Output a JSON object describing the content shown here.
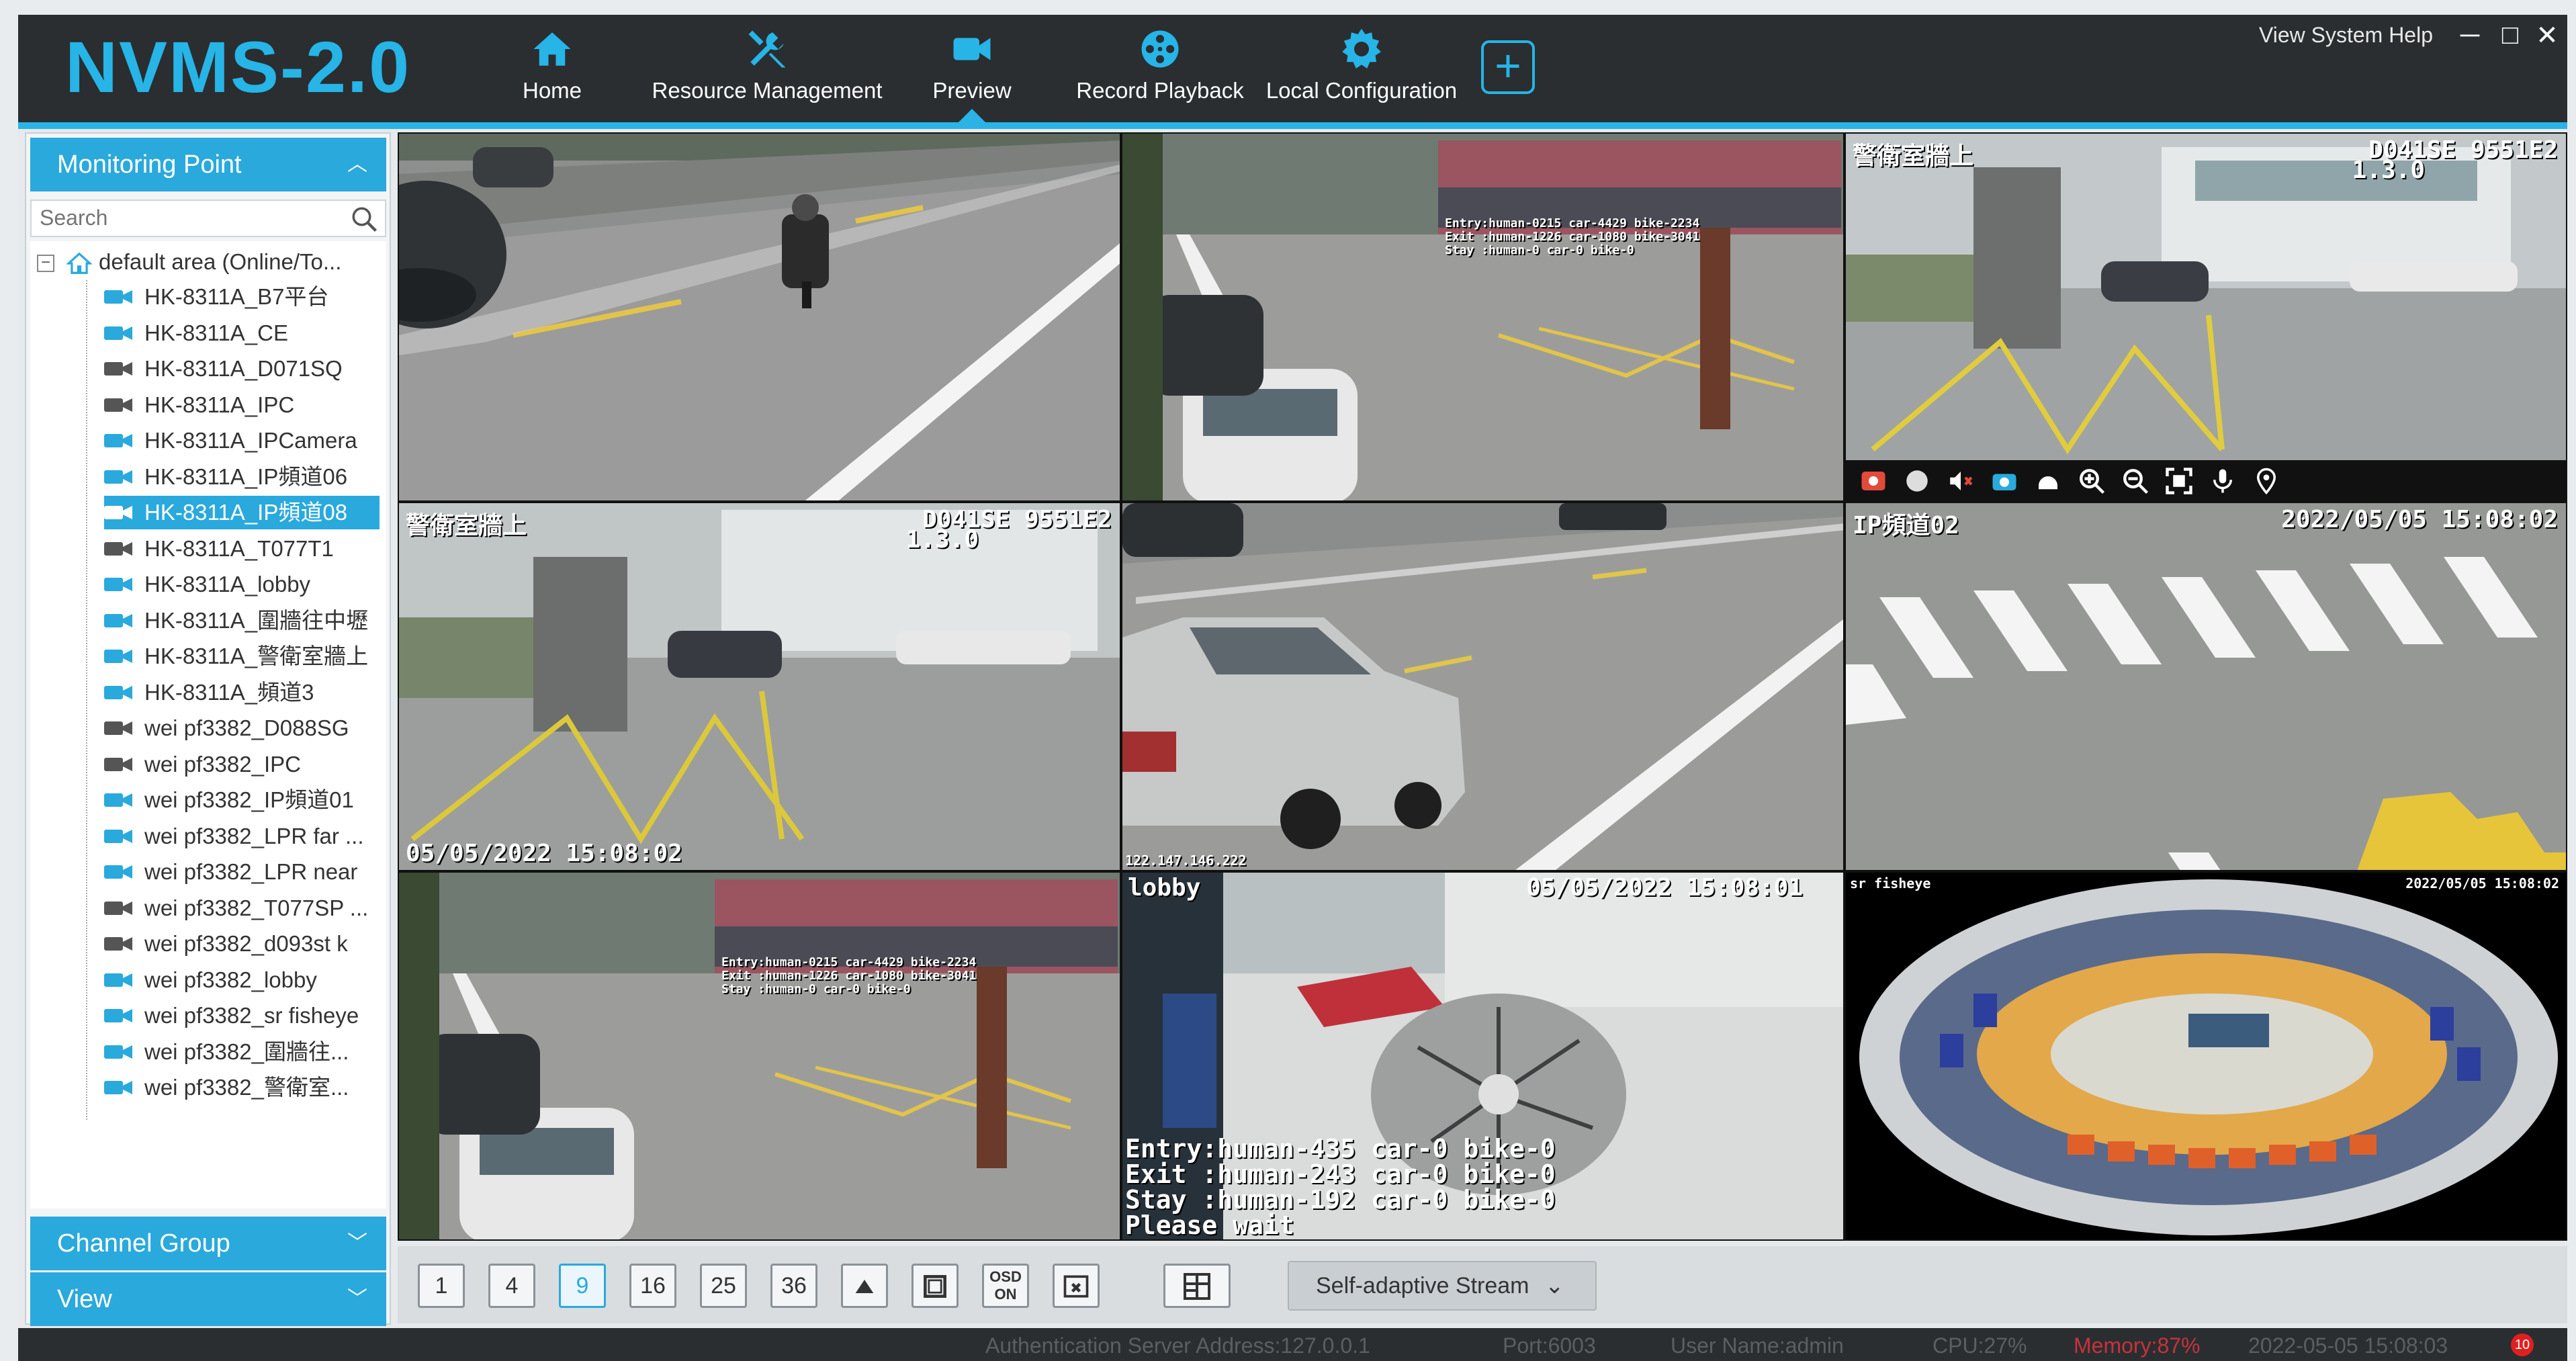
{
  "app": {
    "title": "NVMS-2.0"
  },
  "nav": {
    "home": "Home",
    "resource": "Resource Management",
    "preview": "Preview",
    "playback": "Record Playback",
    "local": "Local Configuration",
    "add": "+"
  },
  "system_menu": {
    "label": "View System Help"
  },
  "window_controls": {
    "minimize": "─",
    "maximize": "□",
    "close": "✕"
  },
  "left_panel": {
    "monitoring_point": "Monitoring Point",
    "search_placeholder": "Search",
    "root": "default area (Online/To...",
    "items": [
      {
        "label": "HK-8311A_B7平台",
        "online": true
      },
      {
        "label": "HK-8311A_CE",
        "online": true
      },
      {
        "label": "HK-8311A_D071SQ",
        "online": false
      },
      {
        "label": "HK-8311A_IPC",
        "online": false
      },
      {
        "label": "HK-8311A_IPCamera",
        "online": true
      },
      {
        "label": "HK-8311A_IP頻道06",
        "online": true
      },
      {
        "label": "HK-8311A_IP頻道08",
        "online": true,
        "selected": true
      },
      {
        "label": "HK-8311A_T077T1",
        "online": false
      },
      {
        "label": "HK-8311A_lobby",
        "online": true
      },
      {
        "label": "HK-8311A_圍牆往中壢",
        "online": true
      },
      {
        "label": "HK-8311A_警衛室牆上",
        "online": true
      },
      {
        "label": "HK-8311A_頻道3",
        "online": true
      },
      {
        "label": "wei pf3382_D088SG",
        "online": false
      },
      {
        "label": "wei pf3382_IPC",
        "online": false
      },
      {
        "label": "wei pf3382_IP頻道01",
        "online": true
      },
      {
        "label": "wei pf3382_LPR far ...",
        "online": true
      },
      {
        "label": "wei pf3382_LPR near",
        "online": true
      },
      {
        "label": "wei pf3382_T077SP ...",
        "online": false
      },
      {
        "label": "wei pf3382_d093st k",
        "online": false
      },
      {
        "label": "wei pf3382_lobby",
        "online": true
      },
      {
        "label": "wei pf3382_sr fisheye",
        "online": true
      },
      {
        "label": "wei pf3382_圍牆往...",
        "online": true
      },
      {
        "label": "wei pf3382_警衛室...",
        "online": true
      }
    ],
    "channel_group": "Channel Group",
    "view": "View"
  },
  "cells": {
    "c3": {
      "title": "警衛室牆上",
      "cam_id": "D041SE 9551E2",
      "sub": "1.3.0"
    },
    "c4": {
      "title": "警衛室牆上",
      "cam_id": "D041SE 9551E2",
      "sub": "1.3.0",
      "timestamp": "05/05/2022 15:08:02"
    },
    "c5": {
      "ip": "122.147.146.222"
    },
    "c6": {
      "title": "IP頻道02",
      "timestamp": "2022/05/05 15:08:02"
    },
    "c8": {
      "title": "lobby",
      "timestamp": "05/05/2022 15:08:01",
      "count_text": "Entry:human-435 car-0 bike-0\nExit :human-243 car-0 bike-0\nStay :human-192 car-0 bike-0\nPlease wait"
    },
    "c9": {
      "title": "sr fisheye",
      "timestamp": "2022/05/05 15:08:02"
    }
  },
  "bottom_toolbar": {
    "layouts": [
      "1",
      "4",
      "9",
      "16",
      "25",
      "36"
    ],
    "osd_line1": "OSD",
    "osd_line2": "ON",
    "stream": "Self-adaptive Stream"
  },
  "status": {
    "auth": "Authentication Server Address:127.0.0.1",
    "port": "Port:6003",
    "user": "User Name:admin",
    "cpu": "CPU:27%",
    "memory": "Memory:87%",
    "datetime": "2022-05-05 15:08:03",
    "alarm_count": "10"
  },
  "colors": {
    "accent": "#2aa9dc",
    "logo": "#27b4e6",
    "topbar": "#2a2e31",
    "memory_warning": "#c8323a"
  }
}
